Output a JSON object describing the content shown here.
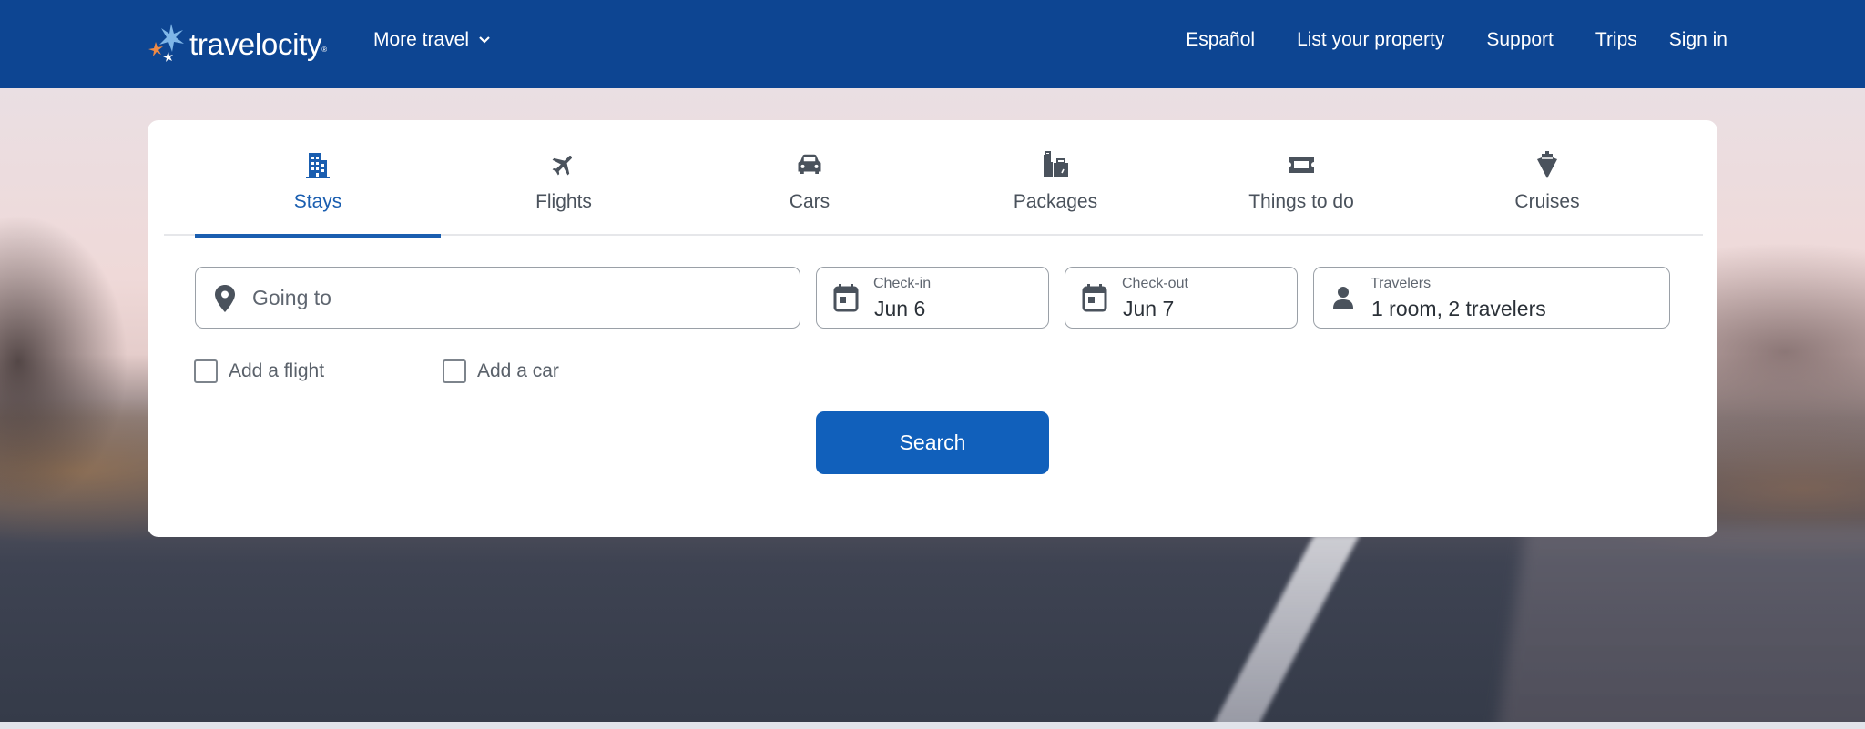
{
  "header": {
    "logo_text": "travelocity",
    "logo_reg": "®",
    "more_travel": "More travel",
    "nav": [
      "Español",
      "List your property",
      "Support",
      "Trips",
      "Sign in"
    ]
  },
  "tabs": [
    {
      "label": "Stays",
      "icon": "building-icon",
      "active": true
    },
    {
      "label": "Flights",
      "icon": "airplane-icon",
      "active": false
    },
    {
      "label": "Cars",
      "icon": "car-icon",
      "active": false
    },
    {
      "label": "Packages",
      "icon": "luggage-icon",
      "active": false
    },
    {
      "label": "Things to do",
      "icon": "ticket-icon",
      "active": false
    },
    {
      "label": "Cruises",
      "icon": "ship-icon",
      "active": false
    }
  ],
  "search": {
    "destination_placeholder": "Going to",
    "checkin_label": "Check-in",
    "checkin_value": "Jun 6",
    "checkout_label": "Check-out",
    "checkout_value": "Jun 7",
    "travelers_label": "Travelers",
    "travelers_value": "1 room, 2 travelers",
    "add_flight": "Add a flight",
    "add_flight_checked": false,
    "add_car": "Add a car",
    "add_car_checked": false,
    "button": "Search"
  },
  "colors": {
    "header_bg": "#0d4592",
    "accent": "#1a5eb0",
    "button_bg": "#1160bb",
    "logo_orange": "#f08a44",
    "logo_lightblue": "#7fb6e8"
  }
}
